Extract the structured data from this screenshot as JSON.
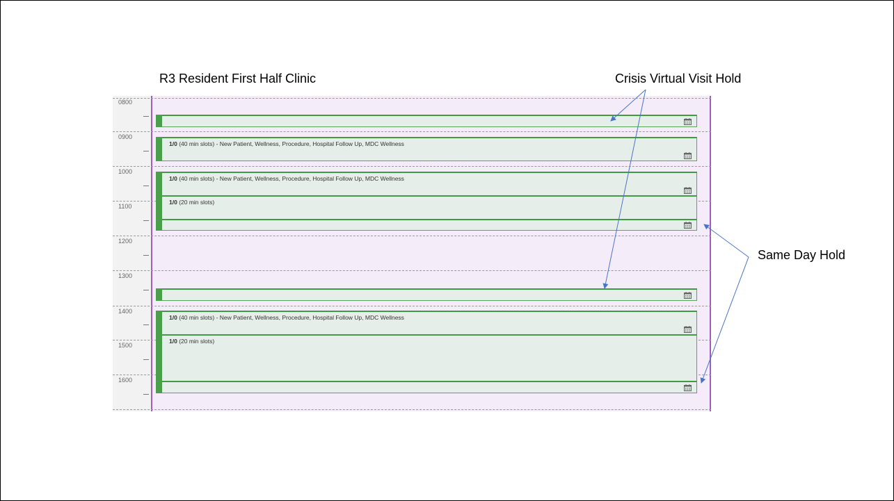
{
  "annotations": {
    "clinic_title": "R3 Resident First Half Clinic",
    "crisis_label": "Crisis Virtual Visit Hold",
    "same_day_label": "Same Day Hold"
  },
  "hours": [
    "0800",
    "0900",
    "1000",
    "1100",
    "1200",
    "1300",
    "1400",
    "1500",
    "1600"
  ],
  "slots": [
    {
      "count": "",
      "desc": ""
    },
    {
      "count": "1/0",
      "desc": " (40 min slots) - New Patient, Wellness, Procedure, Hospital Follow Up, MDC Wellness"
    },
    {
      "count": "1/0",
      "desc": " (40 min slots) - New Patient, Wellness, Procedure, Hospital Follow Up, MDC Wellness"
    },
    {
      "count": "1/0",
      "desc": " (20 min slots)"
    },
    {
      "count": "",
      "desc": ""
    },
    {
      "count": "",
      "desc": ""
    },
    {
      "count": "1/0",
      "desc": " (40 min slots) - New Patient, Wellness, Procedure, Hospital Follow Up, MDC Wellness"
    },
    {
      "count": "1/0",
      "desc": " (20 min slots)"
    },
    {
      "count": "",
      "desc": ""
    }
  ],
  "colors": {
    "slot_bar": "#4a9f4a",
    "column_bg": "#f4ecf9",
    "column_border": "#9b5fc0",
    "arrow": "#4a74c9"
  },
  "icons": [
    "calendar-icon"
  ]
}
